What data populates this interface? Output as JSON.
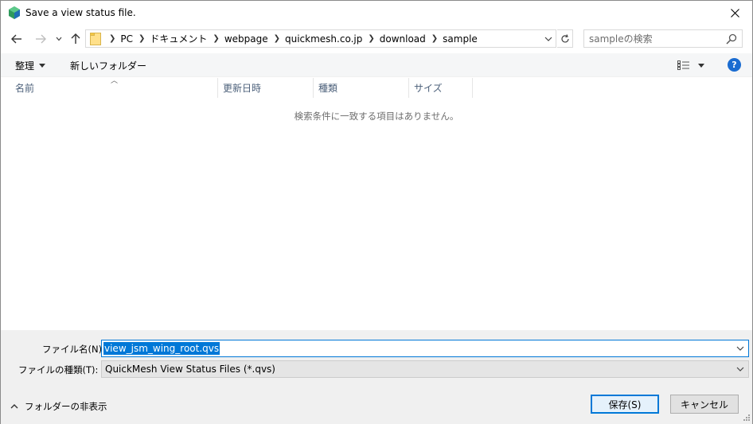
{
  "window": {
    "title": "Save a view status file."
  },
  "address": {
    "crumbs": [
      "PC",
      "ドキュメント",
      "webpage",
      "quickmesh.co.jp",
      "download",
      "sample"
    ]
  },
  "search": {
    "placeholder": "sampleの検索"
  },
  "toolbar": {
    "organize_label": "整理",
    "new_folder_label": "新しいフォルダー"
  },
  "columns": {
    "name": "名前",
    "modified": "更新日時",
    "type": "種類",
    "size": "サイズ"
  },
  "file_list": {
    "empty_message": "検索条件に一致する項目はありません。"
  },
  "form": {
    "filename_label": "ファイル名(N):",
    "filename_value": "view_jsm_wing_root.qvs",
    "filetype_label": "ファイルの種類(T):",
    "filetype_value": "QuickMesh View Status Files (*.qvs)"
  },
  "footer": {
    "hide_folders_label": "フォルダーの非表示",
    "save_label": "保存(S)",
    "cancel_label": "キャンセル"
  },
  "colors": {
    "accent": "#0078d7",
    "help": "#1a6cd1",
    "header_text": "#4c607a"
  }
}
